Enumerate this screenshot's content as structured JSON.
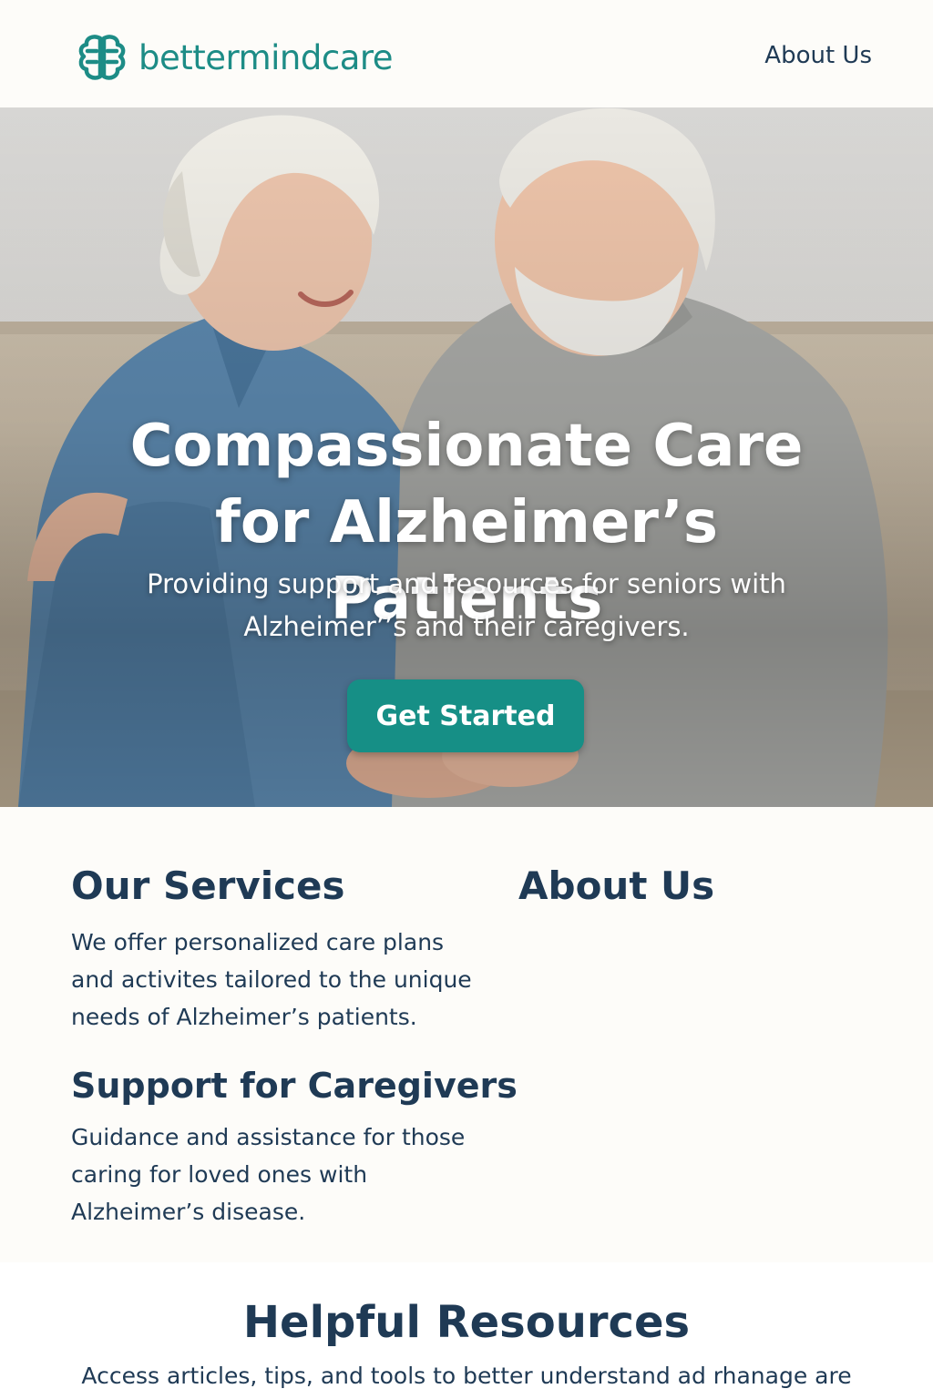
{
  "header": {
    "logo_text": "bettermindcare",
    "nav_about": "About Us"
  },
  "hero": {
    "title": "Compassionate Care for Alzheimer’s Patients",
    "subtitle": "Providing support and resources for seniors with Alzheimer’’s and their caregivers.",
    "cta_label": "Get Started",
    "image_icon": "elderly-couple-photo"
  },
  "services": {
    "title": "Our Services",
    "text": "We offer personalized care plans and activites tailored to the unique needs of Alzheimer’s patients."
  },
  "about": {
    "title": "About Us"
  },
  "support": {
    "title": "Support for Caregivers",
    "text": "Guidance and assistance for those caring for loved ones with Alzheimer’s disease."
  },
  "resources": {
    "title": "Helpful Resources",
    "text": "Access articles, tips, and tools to better understand ad rhanage are"
  },
  "colors": {
    "brand": "#1d8c86",
    "cta": "#168f86",
    "heading": "#1f3a55",
    "background": "#fdfcf9"
  }
}
